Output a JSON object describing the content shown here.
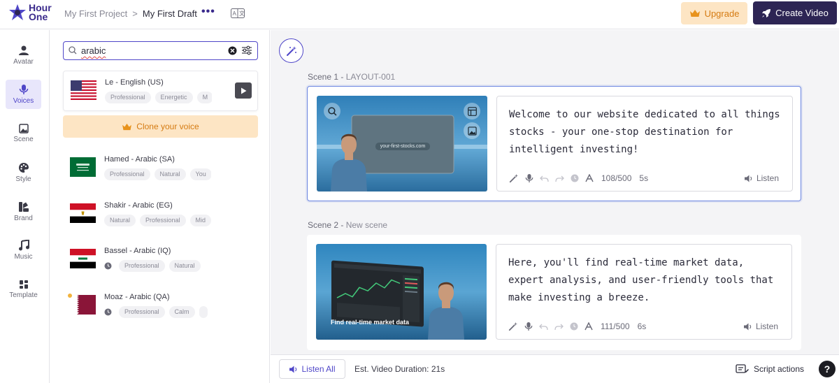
{
  "header": {
    "logo_line1": "Hour",
    "logo_line2": "One",
    "breadcrumb_project": "My First Project",
    "breadcrumb_separator": ">",
    "breadcrumb_draft": "My First Draft",
    "more_label": "•••",
    "upgrade_label": "Upgrade",
    "create_label": "Create Video"
  },
  "nav": [
    {
      "label": "Avatar",
      "icon": "person-icon",
      "active": false
    },
    {
      "label": "Voices",
      "icon": "microphone-icon",
      "active": true
    },
    {
      "label": "Scene",
      "icon": "image-icon",
      "active": false
    },
    {
      "label": "Style",
      "icon": "palette-icon",
      "active": false
    },
    {
      "label": "Brand",
      "icon": "brand-icon",
      "active": false
    },
    {
      "label": "Music",
      "icon": "music-note-icon",
      "active": false
    },
    {
      "label": "Template",
      "icon": "template-icon",
      "active": false
    }
  ],
  "voice_panel": {
    "search_value": "arabic",
    "clone_label": "Clone your voice",
    "voices": [
      {
        "name": "Le - English (US)",
        "flag": "us",
        "tags": [
          "Professional",
          "Energetic",
          "M"
        ],
        "clock": false,
        "selected": true
      },
      {
        "name": "Hamed - Arabic (SA)",
        "flag": "sa",
        "tags": [
          "Professional",
          "Natural",
          "You"
        ],
        "clock": false,
        "selected": false
      },
      {
        "name": "Shakir - Arabic (EG)",
        "flag": "eg",
        "tags": [
          "Natural",
          "Professional",
          "Mid"
        ],
        "clock": false,
        "selected": false
      },
      {
        "name": "Bassel - Arabic (IQ)",
        "flag": "iq",
        "tags": [
          "Professional",
          "Natural"
        ],
        "clock": true,
        "selected": false
      },
      {
        "name": "Moaz - Arabic (QA)",
        "flag": "qa",
        "tags": [
          "Professional",
          "Calm",
          ""
        ],
        "clock": true,
        "selected": false
      }
    ]
  },
  "scenes": [
    {
      "label": "Scene 1 - ",
      "sublabel": "LAYOUT-001",
      "thumb_caption": "your-first-stocks.com",
      "script": "Welcome to our website dedicated to all things stocks - your one-stop destination for intelligent investing!",
      "char_count": "108/500",
      "duration": "5s",
      "listen_label": "Listen"
    },
    {
      "label": "Scene 2 - ",
      "sublabel": "New scene",
      "thumb_caption": "Find real-time market data",
      "script": "Here, you'll find real-time market data, expert analysis, and user-friendly tools that make investing a breeze.",
      "char_count": "111/500",
      "duration": "6s",
      "listen_label": "Listen"
    }
  ],
  "footer": {
    "listen_all_label": "Listen All",
    "est_duration": "Est. Video Duration: 21s",
    "script_actions_label": "Script actions",
    "help_label": "?"
  },
  "colors": {
    "accent": "#4f46c8",
    "brand_dark": "#2d2554",
    "upgrade_bg": "#fde5c4",
    "upgrade_text": "#d57b12"
  }
}
